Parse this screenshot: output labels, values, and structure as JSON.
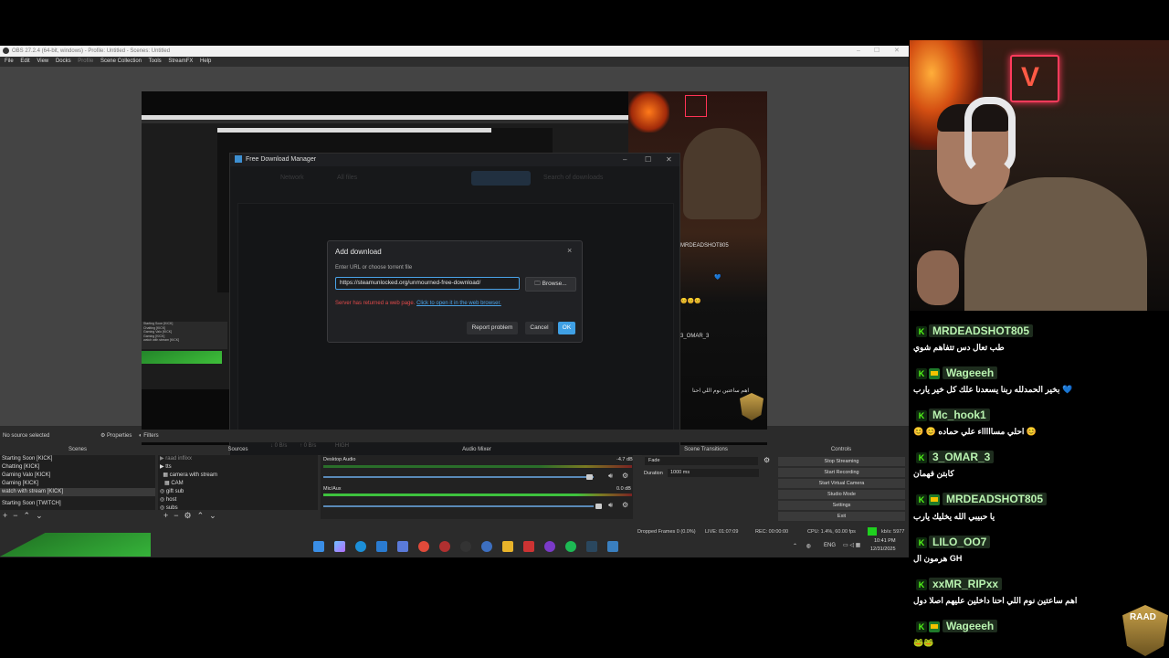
{
  "obs": {
    "title": "OBS 27.2.4 (64-bit, windows) - Profile: Untitled - Scenes: Untitled",
    "menu": [
      "File",
      "Edit",
      "View",
      "Docks",
      "Profile",
      "Scene Collection",
      "Tools",
      "StreamFX",
      "Help"
    ],
    "no_source": "No source selected",
    "properties": "Properties",
    "filters": "Filters",
    "docks": {
      "scenes": "Scenes",
      "sources": "Sources",
      "audio_mixer": "Audio Mixer",
      "scene_transitions": "Scene Transitions",
      "controls": "Controls"
    },
    "scenes": [
      "Starting Soon [KICK]",
      "Chatting [KICK]",
      "Gaming Valo [KICK]",
      "Gaming [KICK]",
      "watch with stream [KICK]",
      "Starting Soon [TWITCH]"
    ],
    "sources": [
      "raad inflixx",
      "tts",
      "camera with stream",
      "CAM",
      "gift sub",
      "host",
      "subs"
    ],
    "mixer": {
      "desktop_audio": "Desktop Audio",
      "desktop_db": "-4.7 dB",
      "mic_aux": "Mic/Aux",
      "mic_db": "0.0 dB"
    },
    "transitions": {
      "type": "Fade",
      "duration_label": "Duration",
      "duration_value": "1000 ms"
    },
    "controls": [
      "Stop Streaming",
      "Start Recording",
      "Start Virtual Camera",
      "Studio Mode",
      "Settings",
      "Exit"
    ],
    "status": {
      "dropped": "Dropped Frames 0 (0.0%)",
      "live": "LIVE: 01:07:09",
      "rec": "REC: 00:00:00",
      "cpu": "CPU: 1.4%, 60.00 fps",
      "kbps": "kb/s: 5977"
    }
  },
  "fdm": {
    "title": "Free Download Manager",
    "toolbar_network": "Network",
    "toolbar_all": "All files",
    "search_placeholder": "Search of downloads",
    "status_down": "↓ 0 B/s",
    "status_up": "↑ 0 B/s",
    "status_mode": "HIGH"
  },
  "dialog": {
    "title": "Add download",
    "close": "×",
    "label": "Enter URL or choose torrent file",
    "url": "https://steamunlocked.org/unmourned-free-download/",
    "browse": "Browse...",
    "error": "Server has returned a web page.",
    "error_link": "Click to open it in the web browser.",
    "report": "Report problem",
    "cancel": "Cancel",
    "ok": "OK"
  },
  "preview_mid": {
    "name1": "MRDEADSHOT805",
    "name2": "3_OMAR_3",
    "msg": "اهم ساعتين نوم اللي احنا",
    "heart": "💙",
    "emojis": "😊😊😊"
  },
  "taskbar": {
    "lang": "ENG",
    "time": "10:41 PM",
    "date": "12/31/2025"
  },
  "chat": [
    {
      "name": "MRDEADSHOT805",
      "badge": false,
      "msg": "طب تعال دس تتفاهم شوي"
    },
    {
      "name": "Wageeeh",
      "badge": true,
      "msg": "بخير الحمدلله ربنا يسعدنا علك كل خير يارب 💙"
    },
    {
      "name": "Mc_hook1",
      "badge": false,
      "msg": "😊 😊 احلي مساااااء علي حماده 😊"
    },
    {
      "name": "3_OMAR_3",
      "badge": false,
      "msg": "كابتن فهمان"
    },
    {
      "name": "MRDEADSHOT805",
      "badge": true,
      "msg": "يا حبيبي الله يخليك يارب"
    },
    {
      "name": "LILO_OO7",
      "badge": false,
      "msg": "هرمون ال GH"
    },
    {
      "name": "xxMR_RIPxx",
      "badge": false,
      "msg": "اهم ساعتين نوم اللي احنا داخلين عليهم اصلا دول"
    },
    {
      "name": "Wageeeh",
      "badge": true,
      "msg": "🐸🐸"
    }
  ],
  "logo_text": "RAAD",
  "colors": {
    "kick_green": "#53fc18",
    "ok_blue": "#3fa0e5",
    "error_red": "#e24a4a",
    "link_blue": "#4aa3e8"
  },
  "icons": [
    "windows-start-icon",
    "copilot-icon",
    "edge-icon",
    "store-icon",
    "explorer-icon",
    "chrome-icon",
    "spotify-icon",
    "steam-icon"
  ]
}
